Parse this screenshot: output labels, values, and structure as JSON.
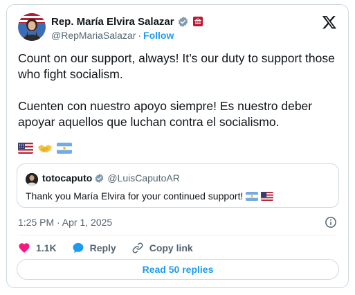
{
  "author": {
    "display_name": "Rep. María Elvira Salazar",
    "handle": "@RepMariaSalazar",
    "separator": "·",
    "follow_label": "Follow"
  },
  "tweet": {
    "paragraph_1": "Count on our support, always! It’s our duty to support those who fight socialism.",
    "paragraph_2": "Cuenten con nuestro apoyo siempre! Es nuestro deber apoyar aquellos que luchan contra el socialismo.",
    "emojis": [
      "us-flag",
      "handshake",
      "argentina-flag"
    ]
  },
  "quote": {
    "display_name": "totocaputo",
    "handle": "@LuisCaputoAR",
    "text": "Thank you María Elvira for your continued support!",
    "emojis": [
      "argentina-flag",
      "us-flag"
    ]
  },
  "meta": {
    "timestamp": "1:25 PM · Apr 1, 2025"
  },
  "actions": {
    "like_count": "1.1K",
    "reply_label": "Reply",
    "copy_label": "Copy link"
  },
  "footer": {
    "read_replies_label": "Read 50 replies"
  },
  "colors": {
    "accent": "#1d9bf0",
    "like": "#f91880",
    "text": "#0f1419",
    "muted": "#536471",
    "border": "#cfd9de"
  }
}
